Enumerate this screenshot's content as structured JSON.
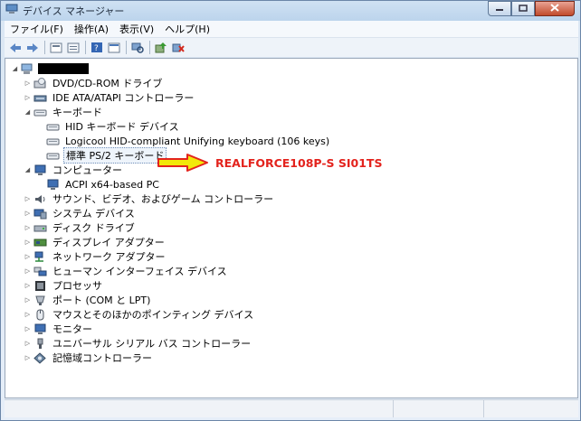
{
  "window": {
    "title": "デバイス マネージャー",
    "icons": {
      "app": "device-manager-icon",
      "minimize": "minimize-icon",
      "maximize": "maximize-icon",
      "close": "close-icon"
    }
  },
  "menu": [
    "ファイル(F)",
    "操作(A)",
    "表示(V)",
    "ヘルプ(H)"
  ],
  "toolbar": [
    "back-arrow-icon",
    "forward-arrow-icon",
    "properties-icon",
    "show-hidden-icon",
    "help-icon",
    "view-icon",
    "scan-hardware-icon",
    "update-driver-icon",
    "uninstall-icon"
  ],
  "tree": {
    "root": {
      "label": "",
      "icon": "computer-icon",
      "redacted": true
    },
    "items": [
      {
        "label": "DVD/CD-ROM ドライブ",
        "icon": "dvd-drive-icon",
        "level": 1,
        "expander": "collapsed"
      },
      {
        "label": "IDE ATA/ATAPI コントローラー",
        "icon": "ide-controller-icon",
        "level": 1,
        "expander": "collapsed"
      },
      {
        "label": "キーボード",
        "icon": "keyboard-icon",
        "level": 1,
        "expander": "expanded"
      },
      {
        "label": "HID キーボード デバイス",
        "icon": "keyboard-icon",
        "level": 2,
        "expander": "none"
      },
      {
        "label": "Logicool HID-compliant Unifying keyboard (106 keys)",
        "icon": "keyboard-icon",
        "level": 2,
        "expander": "none"
      },
      {
        "label": "標準 PS/2 キーボード",
        "icon": "keyboard-icon",
        "level": 2,
        "expander": "none",
        "selected": true
      },
      {
        "label": "コンピューター",
        "icon": "monitor-icon",
        "level": 1,
        "expander": "expanded"
      },
      {
        "label": "ACPI x64-based PC",
        "icon": "monitor-icon",
        "level": 2,
        "expander": "none"
      },
      {
        "label": "サウンド、ビデオ、およびゲーム コントローラー",
        "icon": "speaker-icon",
        "level": 1,
        "expander": "collapsed"
      },
      {
        "label": "システム デバイス",
        "icon": "system-icon",
        "level": 1,
        "expander": "collapsed"
      },
      {
        "label": "ディスク ドライブ",
        "icon": "disk-drive-icon",
        "level": 1,
        "expander": "collapsed"
      },
      {
        "label": "ディスプレイ アダプター",
        "icon": "display-adapter-icon",
        "level": 1,
        "expander": "collapsed"
      },
      {
        "label": "ネットワーク アダプター",
        "icon": "network-icon",
        "level": 1,
        "expander": "collapsed"
      },
      {
        "label": "ヒューマン インターフェイス デバイス",
        "icon": "hid-icon",
        "level": 1,
        "expander": "collapsed"
      },
      {
        "label": "プロセッサ",
        "icon": "processor-icon",
        "level": 1,
        "expander": "collapsed"
      },
      {
        "label": "ポート (COM と LPT)",
        "icon": "port-icon",
        "level": 1,
        "expander": "collapsed"
      },
      {
        "label": "マウスとそのほかのポインティング デバイス",
        "icon": "mouse-icon",
        "level": 1,
        "expander": "collapsed"
      },
      {
        "label": "モニター",
        "icon": "monitor-icon",
        "level": 1,
        "expander": "collapsed"
      },
      {
        "label": "ユニバーサル シリアル バス コントローラー",
        "icon": "usb-icon",
        "level": 1,
        "expander": "collapsed"
      },
      {
        "label": "記憶域コントローラー",
        "icon": "storage-controller-icon",
        "level": 1,
        "expander": "collapsed"
      }
    ]
  },
  "annotation": {
    "text": "REALFORCE108P-S SI01TS",
    "color": "#e3231d",
    "arrow_fill": "#f2e80a",
    "arrow_stroke": "#e3231d"
  },
  "colors": {
    "selection_border": "#6f8fb8",
    "window_frame": "#6b86a8"
  }
}
